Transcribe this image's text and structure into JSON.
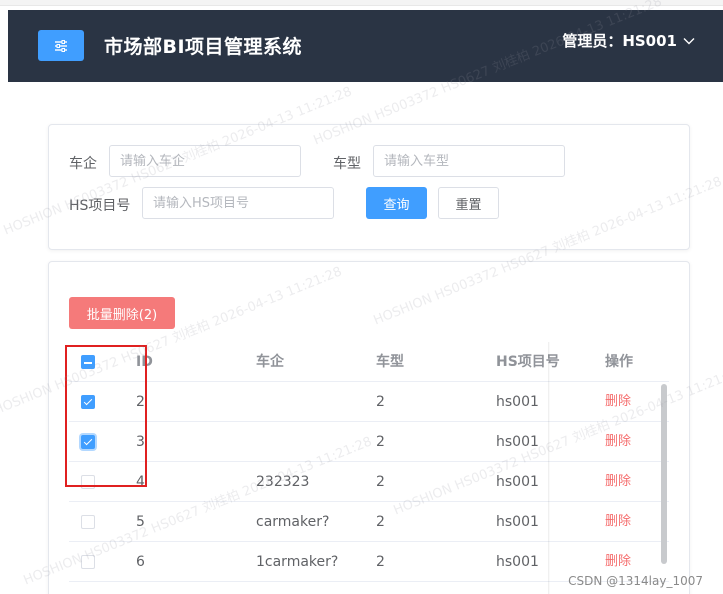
{
  "header": {
    "title": "市场部BI项目管理系统",
    "user_label": "管理员：HS001",
    "menu_icon": "sliders-icon"
  },
  "filter": {
    "automaker_label": "车企",
    "automaker_placeholder": "请输入车企",
    "model_label": "车型",
    "model_placeholder": "请输入车型",
    "hs_label": "HS项目号",
    "hs_placeholder": "请输入HS项目号",
    "query_label": "查询",
    "reset_label": "重置"
  },
  "table": {
    "batch_delete_label": "批量删除(2)",
    "columns": [
      "ID",
      "车企",
      "车型",
      "HS项目号",
      "操作"
    ],
    "rows": [
      {
        "id": "2",
        "automaker": "",
        "model": "2",
        "hs": "hs001",
        "action": "删除",
        "checked": true
      },
      {
        "id": "3",
        "automaker": "",
        "model": "2",
        "hs": "hs001",
        "action": "删除",
        "checked": true
      },
      {
        "id": "4",
        "automaker": "232323",
        "model": "2",
        "hs": "hs001",
        "action": "删除",
        "checked": false
      },
      {
        "id": "5",
        "automaker": "carmaker?",
        "model": "2",
        "hs": "hs001",
        "action": "删除",
        "checked": false
      },
      {
        "id": "6",
        "automaker": "1carmaker?",
        "model": "2",
        "hs": "hs001",
        "action": "删除",
        "checked": false
      }
    ]
  },
  "watermark": {
    "credit": "CSDN @1314lay_1007",
    "overlay_lines": [
      "HOSHION HS003372 HS0627 刘桂柏 2026-04-13 11:21:28"
    ]
  },
  "colors": {
    "header_bg": "#2a3444",
    "primary": "#409eff",
    "danger": "#f56c6c",
    "highlight": "#e02020"
  }
}
